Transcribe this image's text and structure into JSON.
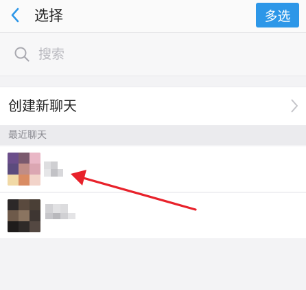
{
  "header": {
    "back_icon": "chevron-left-icon",
    "title": "选择",
    "multi_select_label": "多选",
    "accent_color": "#2d97e8"
  },
  "search": {
    "icon": "search-icon",
    "placeholder": "搜索"
  },
  "new_chat": {
    "label": "创建新聊天",
    "icon": "chevron-right-icon"
  },
  "recent": {
    "section_label": "最近聊天",
    "items": [
      {
        "name": "",
        "avatar": "blurred-avatar"
      },
      {
        "name": "",
        "avatar": "blurred-avatar"
      }
    ]
  },
  "annotation": {
    "arrow_color": "#e8222b"
  }
}
